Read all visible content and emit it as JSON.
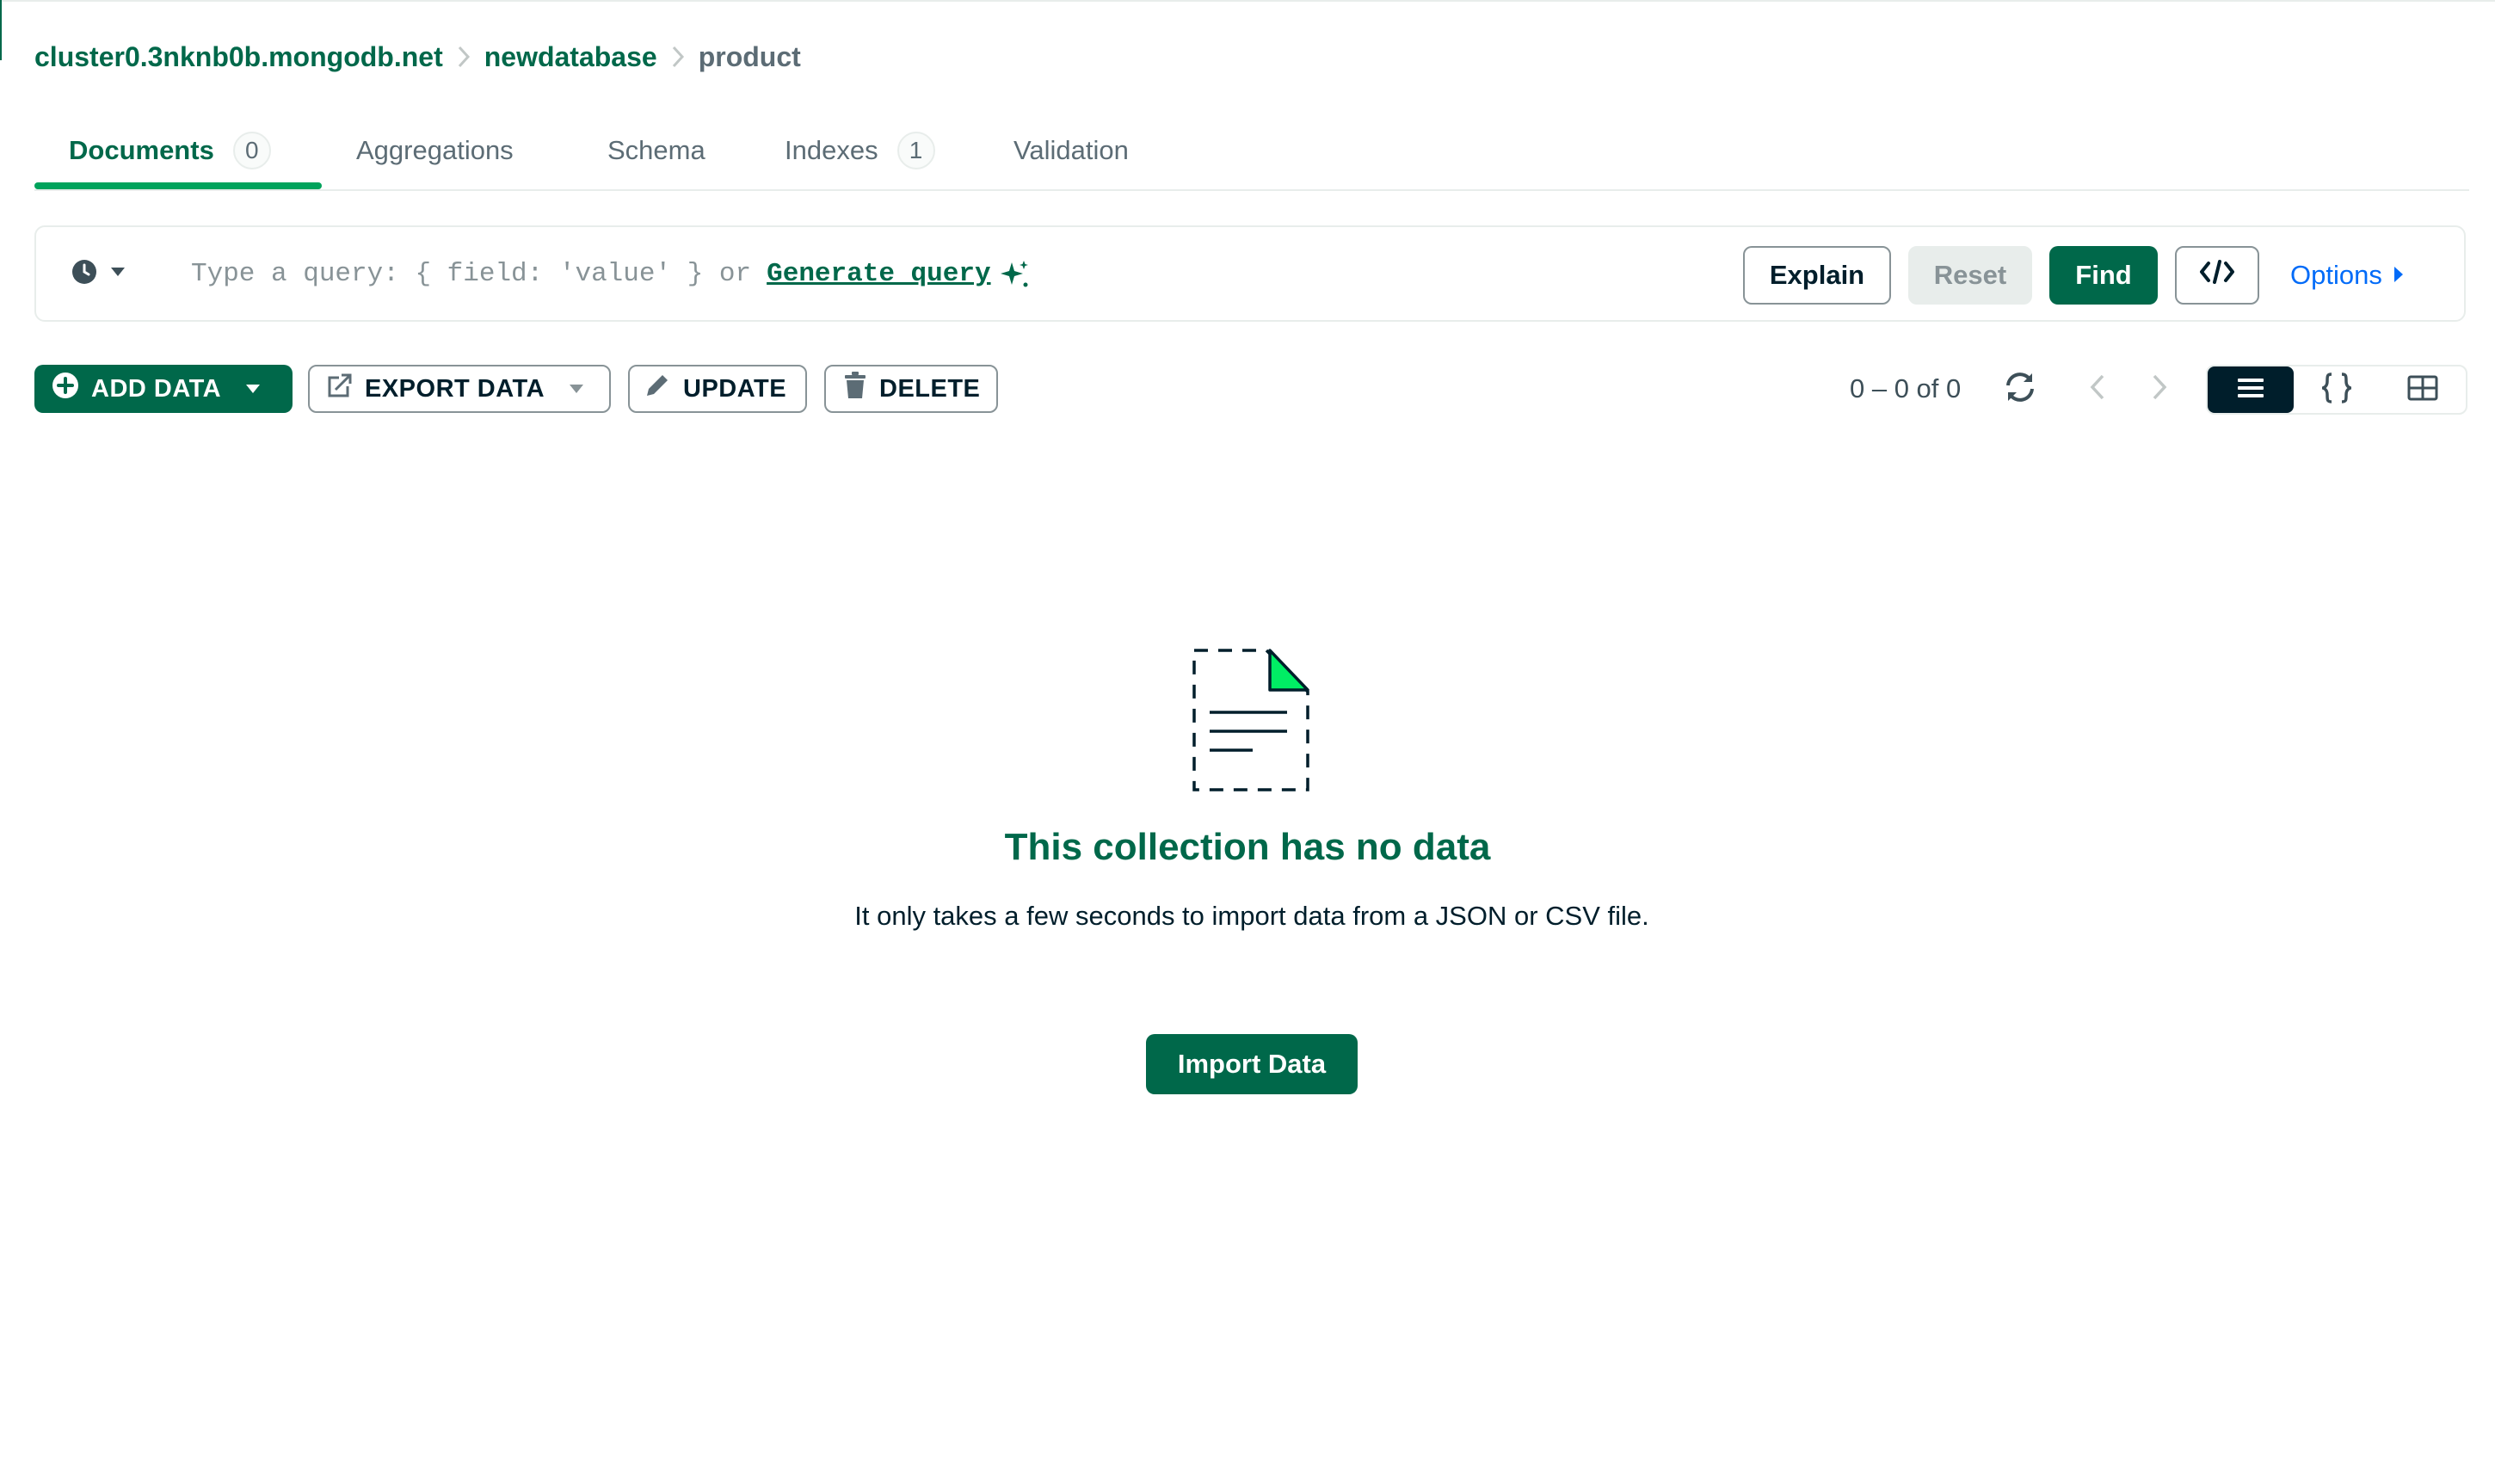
{
  "breadcrumb": {
    "cluster": "cluster0.3nknb0b.mongodb.net",
    "database": "newdatabase",
    "collection": "product"
  },
  "tabs": [
    {
      "label": "Documents",
      "count": "0",
      "active": true
    },
    {
      "label": "Aggregations"
    },
    {
      "label": "Schema"
    },
    {
      "label": "Indexes",
      "count": "1"
    },
    {
      "label": "Validation"
    }
  ],
  "query": {
    "placeholder": "Type a query: { field: 'value' } or",
    "generate_label": "Generate query",
    "explain_label": "Explain",
    "reset_label": "Reset",
    "find_label": "Find",
    "options_label": "Options"
  },
  "toolbar": {
    "add_data_label": "ADD DATA",
    "export_data_label": "EXPORT DATA",
    "update_label": "UPDATE",
    "delete_label": "DELETE",
    "pagination": "0 – 0 of 0"
  },
  "empty_state": {
    "title": "This collection has no data",
    "description": "It only takes a few seconds to import data from a JSON or CSV file.",
    "import_label": "Import Data"
  },
  "colors": {
    "accent": "#00684a",
    "accent_light": "#00ed64",
    "link": "#016bf8",
    "text_muted": "#5c6c75"
  },
  "icons": {
    "history": "clock-icon",
    "generate": "sparkle-icon",
    "code": "code-icon",
    "add": "plus-circle-icon",
    "export": "export-icon",
    "update": "pencil-icon",
    "delete": "trash-icon",
    "refresh": "refresh-icon",
    "list_view": "list-icon",
    "json_view": "braces-icon",
    "table_view": "table-icon",
    "empty": "empty-document-icon"
  }
}
